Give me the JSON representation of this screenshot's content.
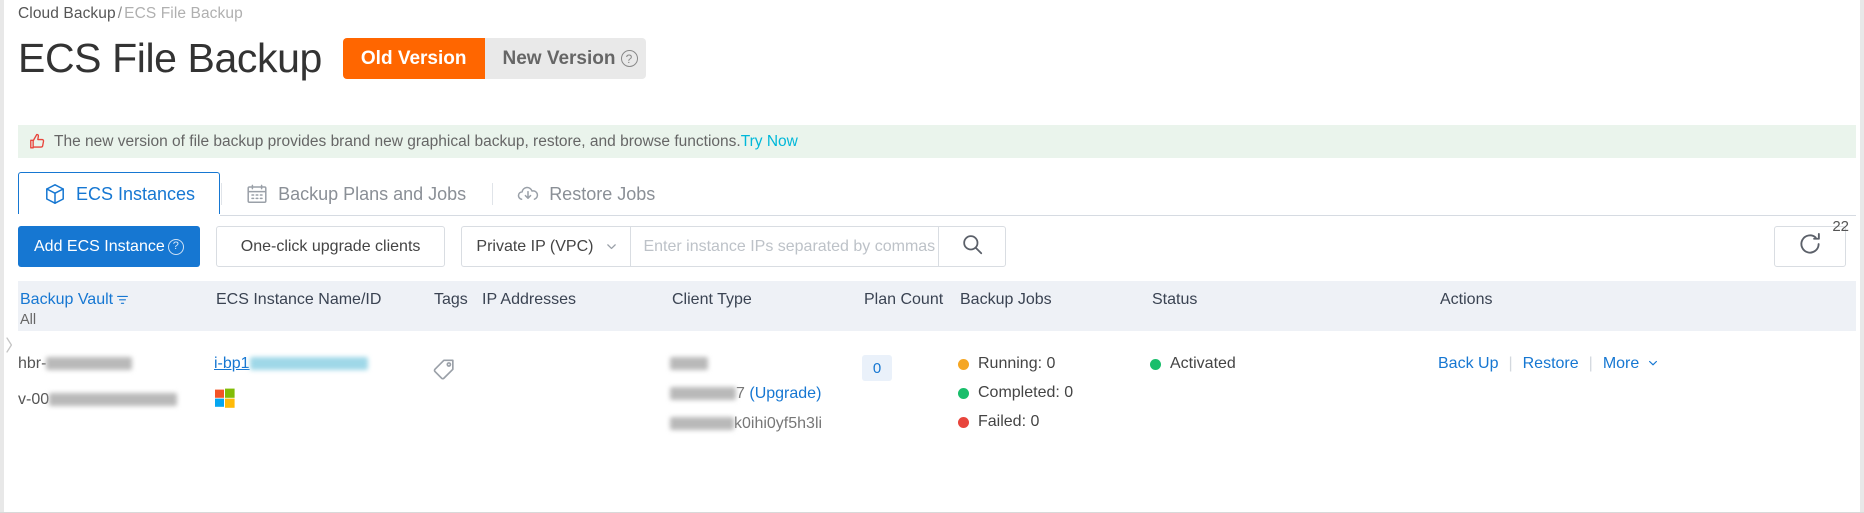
{
  "breadcrumb": {
    "root": "Cloud Backup",
    "separator": "/",
    "current": "ECS File Backup"
  },
  "header": {
    "title": "ECS File Backup",
    "version_toggle": {
      "old_label": "Old Version",
      "new_label": "New Version",
      "help_glyph": "?",
      "active": "Old Version",
      "active_color": "#ff6600"
    }
  },
  "banner": {
    "icon": "thumbs-up-icon",
    "icon_color": "#e8453c",
    "text": "The new version of file backup provides brand new graphical backup, restore, and browse functions.",
    "link_label": "Try Now",
    "link_color": "#00b8d9",
    "background": "#eaf4ec"
  },
  "tabs": [
    {
      "label": "ECS Instances",
      "icon": "cube-icon",
      "active": true
    },
    {
      "label": "Backup Plans and Jobs",
      "icon": "calendar-icon",
      "active": false
    },
    {
      "label": "Restore Jobs",
      "icon": "cloud-download-icon",
      "active": false
    }
  ],
  "toolbar": {
    "add_instance_label": "Add ECS Instance",
    "add_instance_help": "?",
    "upgrade_clients_label": "One-click upgrade clients",
    "ip_type_selected": "Private IP (VPC)",
    "ip_type_options": [
      "Private IP (VPC)"
    ],
    "search_value": "",
    "search_placeholder": "Enter instance IPs separated by commas (,)",
    "search_icon": "search-icon",
    "refresh_icon": "refresh-icon",
    "refresh_badge": "22"
  },
  "table": {
    "columns": [
      {
        "key": "vault",
        "label": "Backup Vault",
        "sub": "All",
        "filter_icon": "filter-icon"
      },
      {
        "key": "name",
        "label": "ECS Instance Name/ID"
      },
      {
        "key": "tags",
        "label": "Tags"
      },
      {
        "key": "ip",
        "label": "IP Addresses"
      },
      {
        "key": "client",
        "label": "Client Type"
      },
      {
        "key": "plan",
        "label": "Plan Count"
      },
      {
        "key": "jobs",
        "label": "Backup Jobs"
      },
      {
        "key": "status",
        "label": "Status"
      },
      {
        "key": "actions",
        "label": "Actions"
      }
    ],
    "rows": [
      {
        "vault_prefix": "hbr-",
        "vault_id_prefix": "v-00",
        "instance_link_prefix": "i-bp1",
        "os_icon": "windows-logo-icon",
        "tags_icon": "tag-icon",
        "client_version_suffix": "7",
        "client_upgrade_label": "(Upgrade)",
        "client_id_suffix": "k0ihi0yf5h3li",
        "plan_count": "0",
        "jobs": [
          {
            "label": "Running: 0",
            "color": "#f5a623"
          },
          {
            "label": "Completed: 0",
            "color": "#19be6b"
          },
          {
            "label": "Failed: 0",
            "color": "#e8453c"
          }
        ],
        "status_label": "Activated",
        "status_color": "#19be6b",
        "actions": {
          "backup": "Back Up",
          "restore": "Restore",
          "more": "More",
          "separator": "|"
        }
      }
    ]
  },
  "colors": {
    "primary": "#1677d2",
    "accent_orange": "#ff6600",
    "header_bg": "#eef1f6",
    "link_cyan": "#00b8d9"
  }
}
